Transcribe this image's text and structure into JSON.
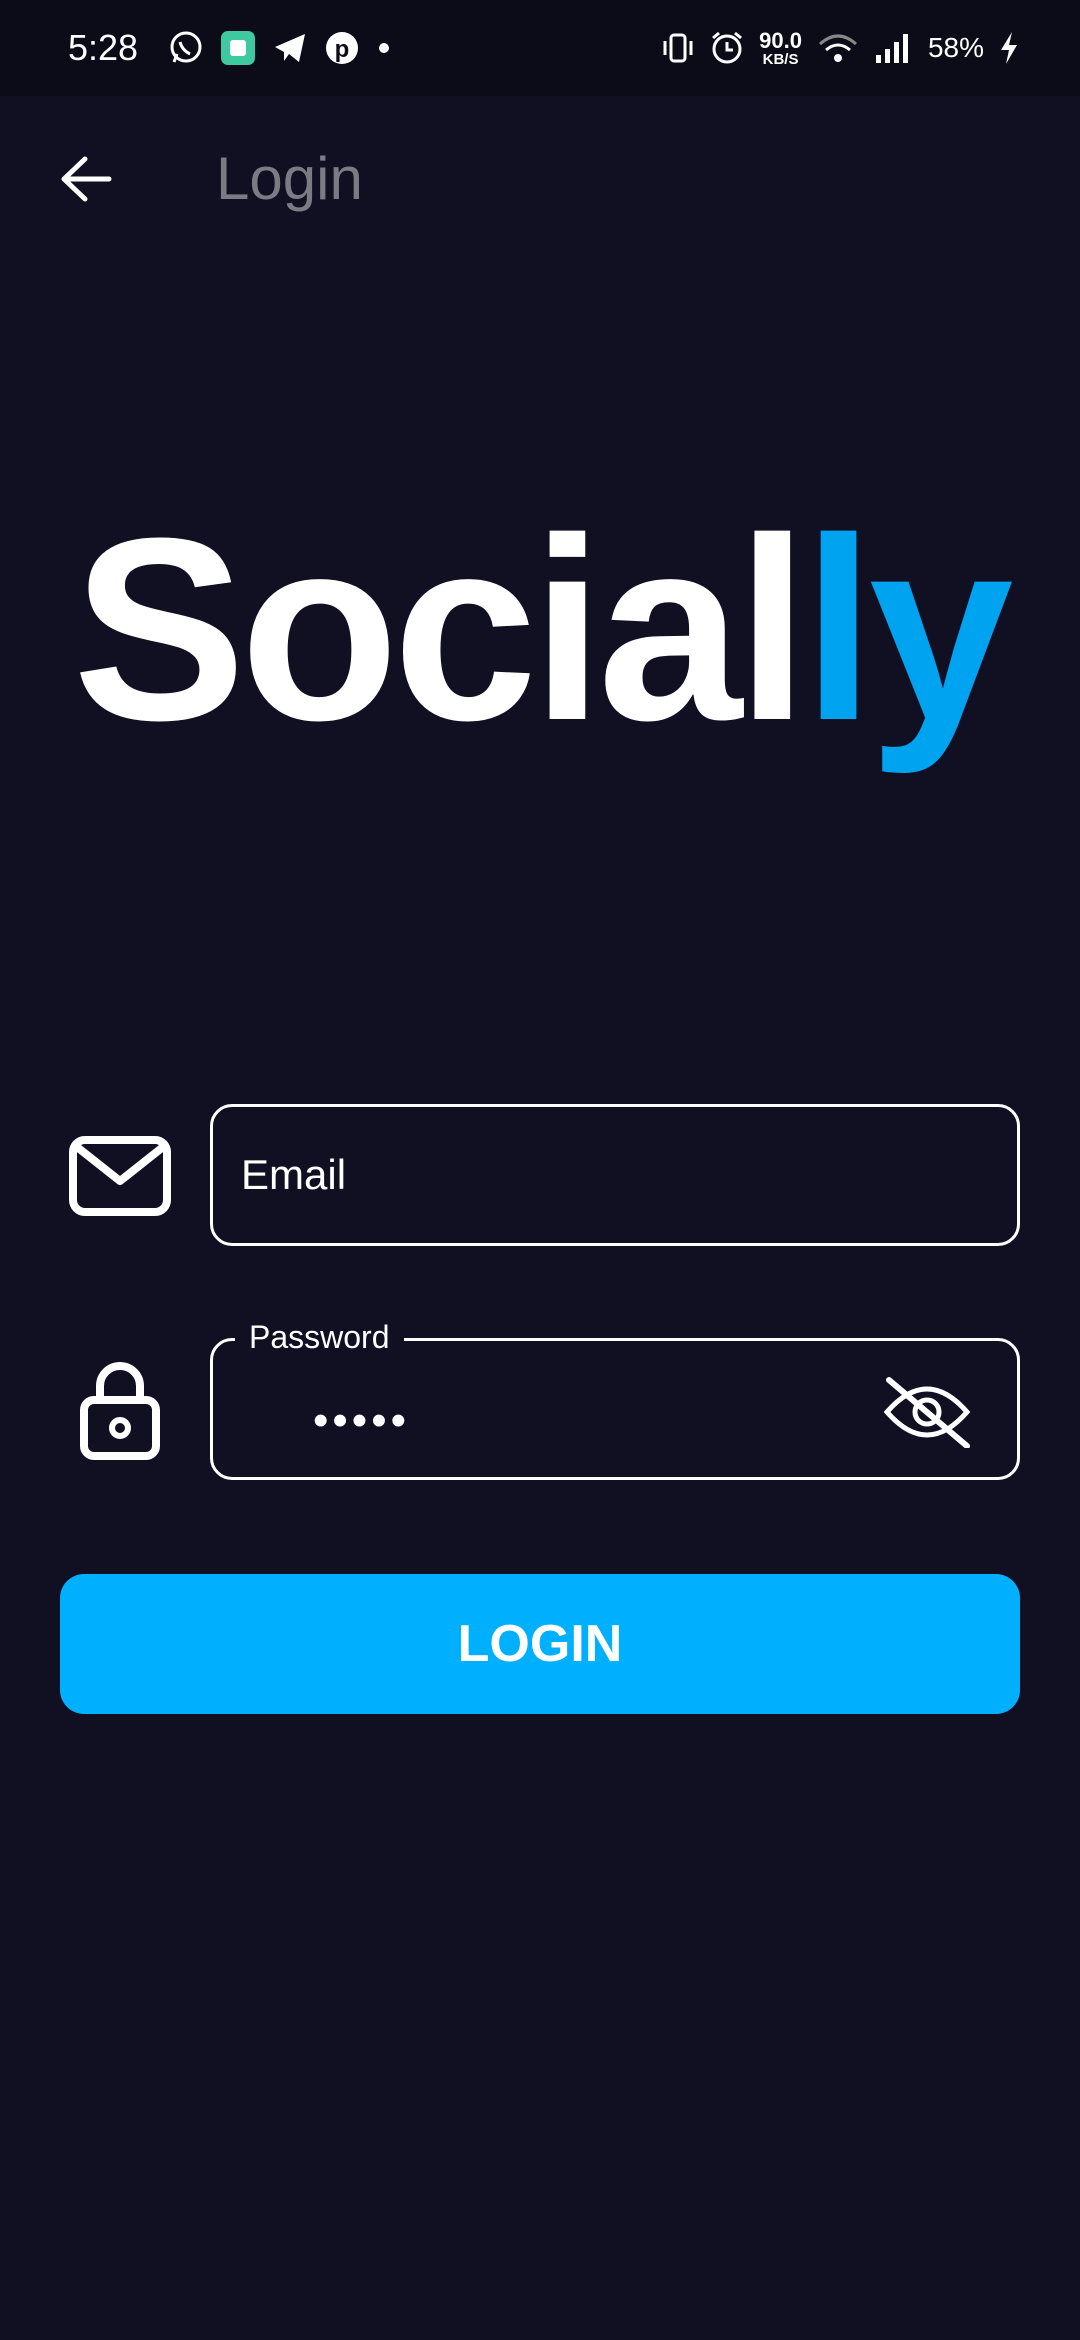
{
  "status_bar": {
    "time": "5:28",
    "net_speed_value": "90.0",
    "net_speed_unit": "KB/S",
    "battery": "58%",
    "icons": [
      "whatsapp-icon",
      "app-icon",
      "telegram-icon",
      "pinterest-icon",
      "dot-icon",
      "vibrate-icon",
      "alarm-icon",
      "wifi-icon",
      "signal-icon",
      "charging-icon"
    ]
  },
  "app_bar": {
    "title": "Login",
    "back_icon": "arrow-left-icon"
  },
  "logo": {
    "main": "Social",
    "accent": "ly",
    "accent_color": "#00a3f0"
  },
  "form": {
    "email": {
      "placeholder": "Email",
      "value": "",
      "icon": "mail-icon"
    },
    "password": {
      "label": "Password",
      "value": "•••••",
      "icon": "lock-icon",
      "toggle_icon": "eye-off-icon"
    },
    "submit_label": "LOGIN"
  },
  "colors": {
    "background": "#110f22",
    "status_bar": "#0c0b18",
    "primary": "#00affd",
    "title_muted": "#7b7b85"
  }
}
